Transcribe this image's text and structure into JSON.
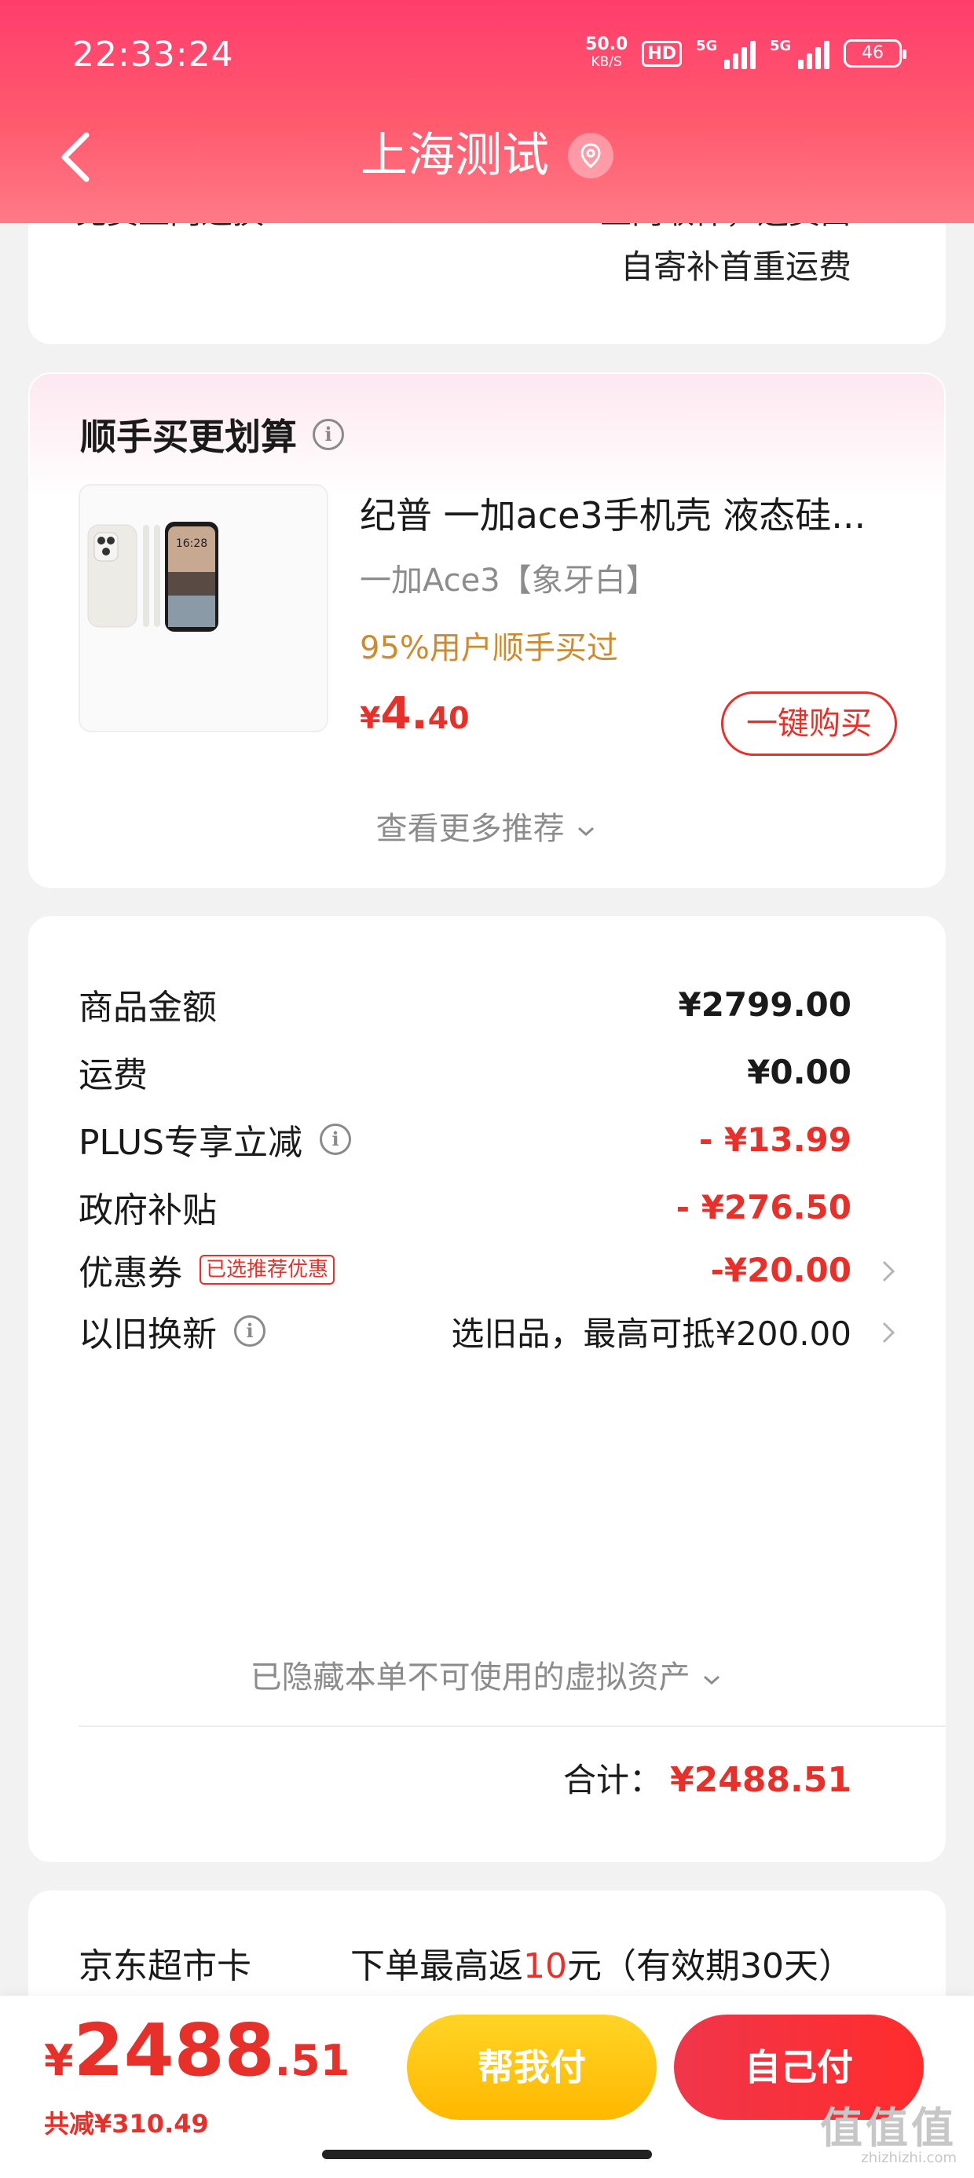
{
  "status_bar": {
    "time": "22:33:24",
    "net_speed_value": "50.0",
    "net_speed_unit": "KB/S",
    "hd_label": "HD",
    "signal1_label": "5G",
    "signal2_label": "5G",
    "battery": "46"
  },
  "header": {
    "title": "上海测试",
    "back_icon": "chevron-left-icon",
    "location_icon": "location-pin-icon",
    "gradient_colors": [
      "#ff3d6c",
      "#ff7a86"
    ]
  },
  "shipping_card": {
    "partial_left": "免费上门退换",
    "partial_right": "上门取件，运费由",
    "note": "自寄补首重运费"
  },
  "addon": {
    "section_title": "顺手买更划算",
    "product_title": "纪普 一加ace3手机壳 液态硅...",
    "product_spec": "一加Ace3【象牙白】",
    "product_tag": "95%用户顺手买过",
    "price_currency": "¥",
    "price_int": "4.",
    "price_dec": "40",
    "buy_label": "一键购买",
    "image_time": "16:28",
    "more_label": "查看更多推荐"
  },
  "summary": {
    "rows": [
      {
        "label": "商品金额",
        "value": "¥2799.00"
      },
      {
        "label": "运费",
        "value": "¥0.00"
      },
      {
        "label": "PLUS专享立减",
        "value": "- ¥13.99"
      },
      {
        "label": "政府补贴",
        "value": "- ¥276.50"
      },
      {
        "label": "优惠券",
        "tag": "已选推荐优惠",
        "value": "-¥20.00"
      },
      {
        "label": "以旧换新",
        "value": "选旧品，最高可抵¥200.00"
      }
    ],
    "hidden_assets": "已隐藏本单不可使用的虚拟资产",
    "total_label": "合计：",
    "total_value": "¥2488.51"
  },
  "supermarket_card": {
    "label": "京东超市卡",
    "desc_prefix": "下单最高返",
    "desc_amount": "10",
    "desc_suffix": "元（有效期30天）"
  },
  "bottom_bar": {
    "currency": "¥",
    "price_int": "2488",
    "price_dec": ".51",
    "saved": "共减¥310.49",
    "help_pay_label": "帮我付",
    "self_pay_label": "自己付",
    "accent": "#e8302a"
  },
  "watermark": {
    "text": "值值值",
    "url": "zhizhizhi.com"
  }
}
